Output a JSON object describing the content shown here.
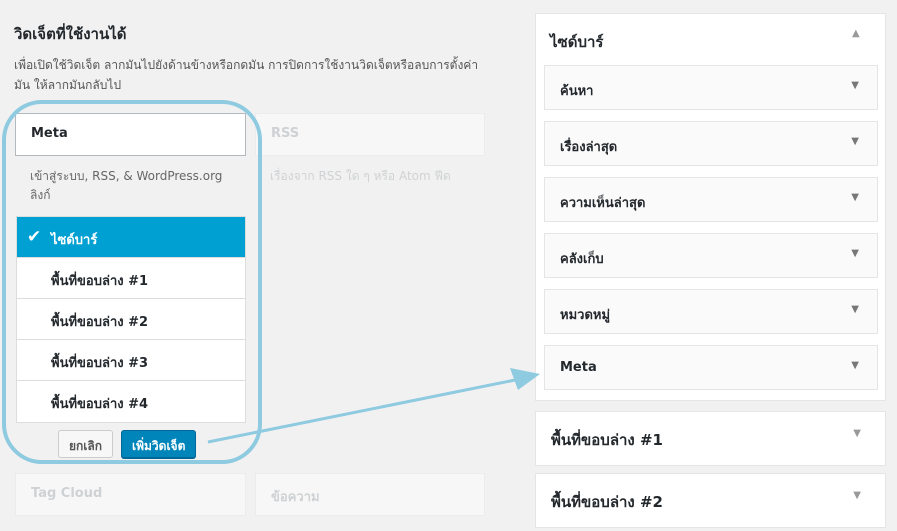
{
  "left": {
    "title": "วิดเจ็ตที่ใช้งานได้",
    "description": "เพื่อเปิดใช้วิดเจ็ต ลากมันไปยังด้านข้างหรือกดมัน การปิดการใช้งานวิดเจ็ตหรือลบการตั้งค่ามัน ให้ลากมันกลับไป"
  },
  "available_widgets": [
    {
      "label": "Meta",
      "description": "เข้าสู่ระบบ, RSS, & WordPress.org ลิงก์"
    },
    {
      "label": "RSS",
      "description": "เรื่องจาก RSS ใด ๆ หรือ Atom ฟีด"
    },
    {
      "label": "Tag Cloud"
    },
    {
      "label": "ข้อความ"
    }
  ],
  "chooser": {
    "items": [
      {
        "label": "ไซด์บาร์",
        "selected": true
      },
      {
        "label": "พื้นที่ขอบล่าง #1"
      },
      {
        "label": "พื้นที่ขอบล่าง #2"
      },
      {
        "label": "พื้นที่ขอบล่าง #3"
      },
      {
        "label": "พื้นที่ขอบล่าง #4"
      }
    ],
    "cancel_label": "ยกเลิก",
    "add_label": "เพิ่มวิดเจ็ต"
  },
  "sidebar": {
    "title": "ไซด์บาร์",
    "widgets": [
      {
        "label": "ค้นหา"
      },
      {
        "label": "เรื่องล่าสุด"
      },
      {
        "label": "ความเห็นล่าสุด"
      },
      {
        "label": "คลังเก็บ"
      },
      {
        "label": "หมวดหมู่"
      },
      {
        "label": "Meta"
      }
    ]
  },
  "widget_areas": [
    {
      "label": "พื้นที่ขอบล่าง #1"
    },
    {
      "label": "พื้นที่ขอบล่าง #2"
    }
  ],
  "colors": {
    "selected": "#00a0d2",
    "primary_button": "#0085ba",
    "highlight": "#8ecae0"
  }
}
